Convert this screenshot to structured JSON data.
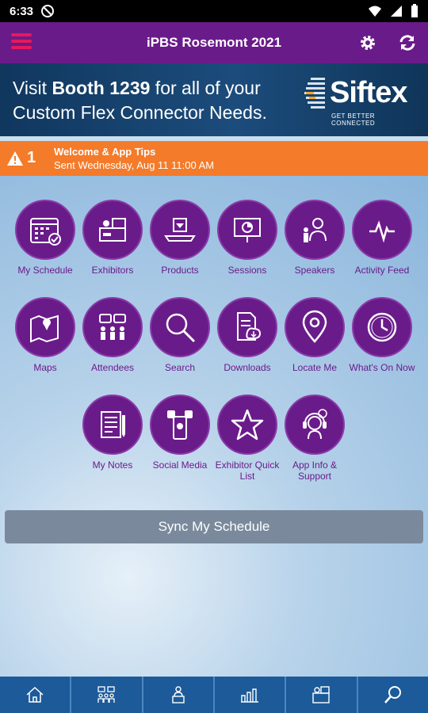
{
  "status_bar": {
    "time": "6:33"
  },
  "app_bar": {
    "title": "iPBS Rosemont 2021"
  },
  "banner": {
    "line1_prefix": "Visit ",
    "line1_bold": "Booth 1239",
    "line1_suffix": " for all of your",
    "line2": "Custom Flex Connector Needs.",
    "brand": "Siftex",
    "tagline": "GET BETTER CONNECTED"
  },
  "notification": {
    "count": "1",
    "title": "Welcome & App Tips",
    "subtitle": "Sent Wednesday, Aug 11 11:00 AM"
  },
  "tiles": [
    {
      "label": "My Schedule",
      "icon": "calendar-icon"
    },
    {
      "label": "Exhibitors",
      "icon": "booth-icon"
    },
    {
      "label": "Products",
      "icon": "product-icon"
    },
    {
      "label": "Sessions",
      "icon": "presentation-icon"
    },
    {
      "label": "Speakers",
      "icon": "speaker-icon"
    },
    {
      "label": "Activity Feed",
      "icon": "pulse-icon"
    },
    {
      "label": "Maps",
      "icon": "map-icon"
    },
    {
      "label": "Attendees",
      "icon": "attendees-icon"
    },
    {
      "label": "Search",
      "icon": "search-icon"
    },
    {
      "label": "Downloads",
      "icon": "download-icon"
    },
    {
      "label": "Locate Me",
      "icon": "location-pin-icon"
    },
    {
      "label": "What's On Now",
      "icon": "clock-icon"
    },
    {
      "label": "My Notes",
      "icon": "notes-icon"
    },
    {
      "label": "Social Media",
      "icon": "social-media-icon"
    },
    {
      "label": "Exhibitor Quick List",
      "icon": "star-icon"
    },
    {
      "label": "App Info & Support",
      "icon": "support-icon"
    }
  ],
  "sync_button": {
    "label": "Sync My Schedule"
  },
  "bottom_nav": [
    {
      "icon": "home-icon"
    },
    {
      "icon": "attendees-icon"
    },
    {
      "icon": "speaker-icon"
    },
    {
      "icon": "activity-icon"
    },
    {
      "icon": "exhibitor-icon"
    },
    {
      "icon": "search-icon"
    }
  ],
  "colors": {
    "app_bar": "#6a1b8a",
    "accent": "#e8185a",
    "notice": "#f47b2a",
    "nav": "#1c5a9a",
    "tile": "#6a1b8a"
  }
}
